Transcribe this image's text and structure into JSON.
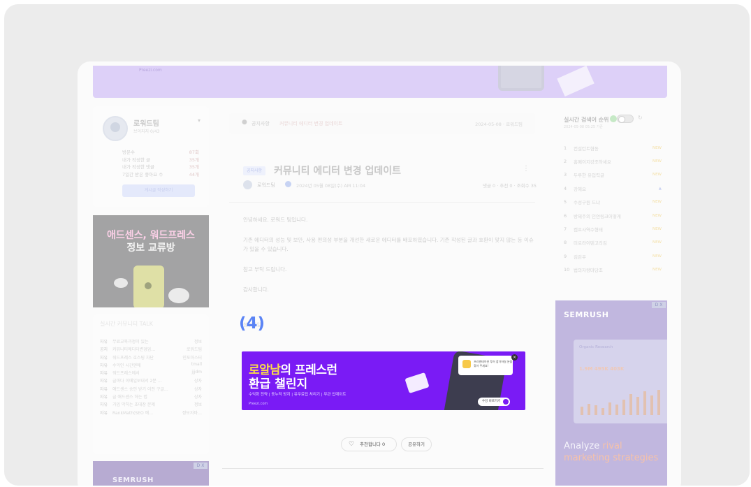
{
  "banner": {
    "logo": "Preezi.com"
  },
  "profile": {
    "name": "로워드팀",
    "subtitle": "브이지지·0/43",
    "stats": [
      {
        "label": "방문수",
        "value": "87회"
      },
      {
        "label": "내가 작성한 글",
        "value": "35개"
      },
      {
        "label": "내가 작성한 댓글",
        "value": "35개"
      },
      {
        "label": "7일간 받은 좋아요 수",
        "value": "44개"
      }
    ],
    "button": "게시글 작성하기"
  },
  "ad_left": {
    "line1": "애드센스, 워드프레스",
    "line2": "정보 교류방"
  },
  "talk": {
    "header": "실시간 커뮤니티 TALK",
    "rows": [
      {
        "cat": "자유",
        "title": "무료교육과정이 있는",
        "author": "정보"
      },
      {
        "cat": "공지",
        "title": "커뮤니티에디터변경업…",
        "author": "로워드팀"
      },
      {
        "cat": "자유",
        "title": "워드프레스 호스팅 차단",
        "author": "인포마스터"
      },
      {
        "cat": "자유",
        "title": "수익인 시간엔에",
        "author": "tmall"
      },
      {
        "cat": "자유",
        "title": "워드프레스에서",
        "author": "jjjdm"
      },
      {
        "cat": "자유",
        "title": "글마다 이메일보내서 2분 …",
        "author": "상자"
      },
      {
        "cat": "자유",
        "title": "애드센스 승인 받기 이전 구글…",
        "author": "상자"
      },
      {
        "cat": "자유",
        "title": "글 애드센스 하는 법",
        "author": "상자"
      },
      {
        "cat": "자유",
        "title": "가입 막히는 초대장 문제",
        "author": "정보"
      },
      {
        "cat": "자유",
        "title": "RankMath(SEO 에…",
        "author": "정보자마…"
      }
    ]
  },
  "semrush_small": {
    "logo": "SEMRUSH",
    "ad_tag": "D X"
  },
  "notice": {
    "icon": "●",
    "label": "공지사항",
    "title": "커뮤니티 에디터 변경 업데이트",
    "date": "2024-05-08 · 로워드팀"
  },
  "post": {
    "badge": "공지사항",
    "title": "커뮤니티 에디터 변경 업데이트",
    "kebab": "⋮",
    "author": "로워드팀",
    "date": "2024년 05월 08일(수) AM 11:04",
    "stats": "댓글 0 · 추천 0 · 조회수 35",
    "body": [
      "안녕하세요. 로워드 팀입니다.",
      "기존 에디터의 성능 및 보안, 사용 편의성 부분을 개선한 새로운 에디터를 배포하였습니다. 기존 작성된 글과 호환이 맞지 않는 등 이슈가 있을 수 있습니다.",
      "참고 부탁 드립니다.",
      "감사합니다."
    ],
    "attachment": "첨부파일",
    "step_label": "(4)"
  },
  "ad_banner": {
    "line1_a": "로알남",
    "line1_b": "의 프레스런",
    "line2": "환급 챌린지",
    "sub": "수익화 전략 | 동누적 방지 | 유무료팁 처리기 | 무관 업데이트",
    "logo": "Preezi.com",
    "card": "프리젠테이션 투어 참가하실 분을 찾아 주세요!",
    "cta": "수강 바로가기",
    "close": "×"
  },
  "actions": {
    "like": "추천합니다 0",
    "heart": "♡",
    "share": "공유하기"
  },
  "ranking": {
    "title": "실시간 검색어 순위",
    "subtitle": "2024-05-08 05:25 기준",
    "refresh": "↻",
    "items": [
      {
        "n": "1",
        "k": "컨설턴트협동",
        "s": "NEW"
      },
      {
        "n": "2",
        "k": "홈페이지강조하세요",
        "s": "NEW"
      },
      {
        "n": "3",
        "k": "두루한 유입력글",
        "s": "NEW"
      },
      {
        "n": "4",
        "k": "강해요",
        "s": "▲"
      },
      {
        "n": "5",
        "k": "수성구원 드냐",
        "s": "NEW"
      },
      {
        "n": "6",
        "k": "방제주의 인연링크어떻게",
        "s": "NEW"
      },
      {
        "n": "7",
        "k": "캠프사역수형태",
        "s": "NEW"
      },
      {
        "n": "8",
        "k": "미로라이텐고리김",
        "s": "NEW"
      },
      {
        "n": "9",
        "k": "김린우",
        "s": "NEW"
      },
      {
        "n": "10",
        "k": "법의자랑마당조",
        "s": "NEW"
      }
    ]
  },
  "semrush_big": {
    "logo": "SEMRUSH",
    "ad_tag": "D X",
    "panel_title": "Organic Research",
    "numbers": "1.9M  495K  403K",
    "cta_a": "Analyze",
    "cta_b": " rival marketing strategies"
  }
}
